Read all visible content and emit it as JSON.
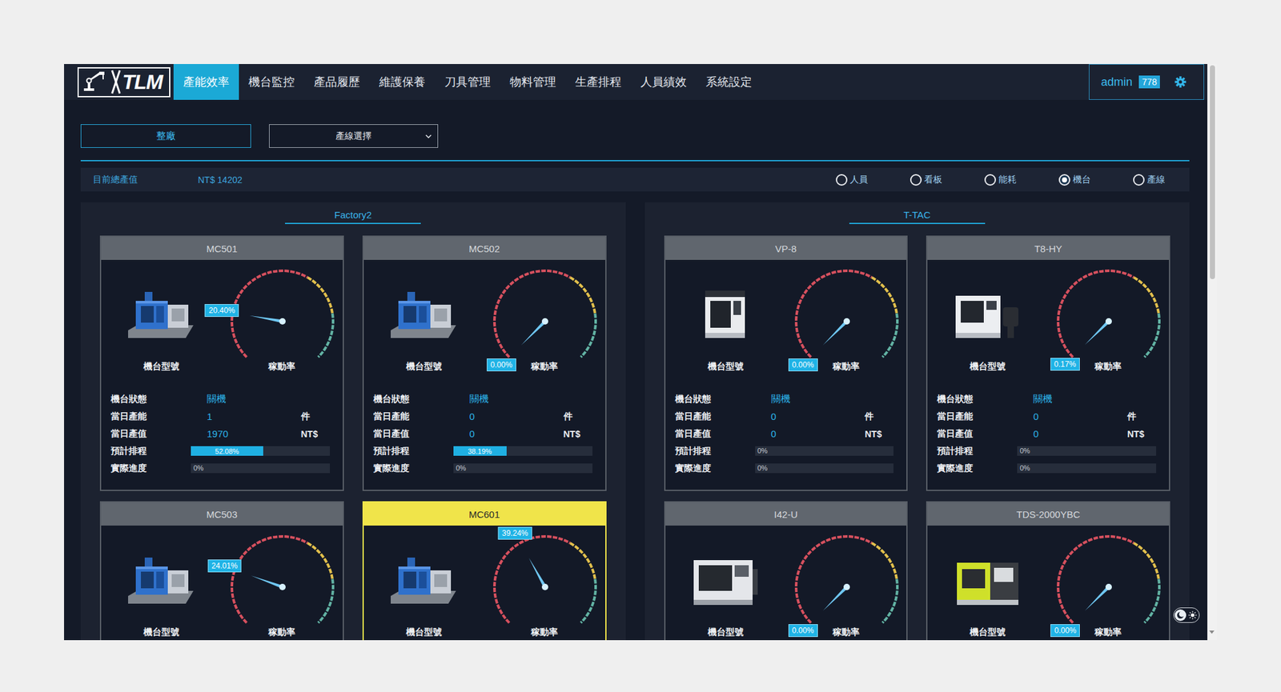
{
  "logo": {
    "text": "TLM"
  },
  "nav": {
    "items": [
      {
        "label": "產能效率",
        "selected": true
      },
      {
        "label": "機台監控",
        "selected": false
      },
      {
        "label": "產品履歷",
        "selected": false
      },
      {
        "label": "維護保養",
        "selected": false
      },
      {
        "label": "刀具管理",
        "selected": false
      },
      {
        "label": "物料管理",
        "selected": false
      },
      {
        "label": "生產排程",
        "selected": false
      },
      {
        "label": "人員績效",
        "selected": false
      },
      {
        "label": "系統設定",
        "selected": false
      }
    ]
  },
  "user": {
    "name": "admin",
    "badge": "778"
  },
  "filters": {
    "scope_button": "整廠",
    "line_select": "產線選擇"
  },
  "summary": {
    "label": "目前總產值",
    "value": "NT$ 14202",
    "views": [
      {
        "label": "人員",
        "selected": false
      },
      {
        "label": "看板",
        "selected": false
      },
      {
        "label": "能耗",
        "selected": false
      },
      {
        "label": "機台",
        "selected": true
      },
      {
        "label": "產線",
        "selected": false
      }
    ]
  },
  "groups": [
    {
      "title": "Factory2",
      "machines": [
        {
          "name": "MC501",
          "highlighted": false,
          "kind": "mill",
          "model_label": "機台型號",
          "gauge_label": "稼動率",
          "utilization": "20.40%",
          "level": 0.204,
          "stats": [
            {
              "kind": "value",
              "label": "機台狀態",
              "value": "關機"
            },
            {
              "kind": "value",
              "label": "當日產能",
              "value": "1",
              "unit": "件"
            },
            {
              "kind": "value",
              "label": "當日產值",
              "value": "1970",
              "unit": "NT$"
            },
            {
              "kind": "bar",
              "label": "預計排程",
              "reading": "52.08%",
              "level": 0.5208
            },
            {
              "kind": "bar",
              "label": "實際進度",
              "reading": "0%",
              "level": 0
            }
          ]
        },
        {
          "name": "MC502",
          "highlighted": false,
          "kind": "mill",
          "model_label": "機台型號",
          "gauge_label": "稼動率",
          "utilization": "0.00%",
          "level": 0,
          "stats": [
            {
              "kind": "value",
              "label": "機台狀態",
              "value": "關機"
            },
            {
              "kind": "value",
              "label": "當日產能",
              "value": "0",
              "unit": "件"
            },
            {
              "kind": "value",
              "label": "當日產值",
              "value": "0",
              "unit": "NT$"
            },
            {
              "kind": "bar",
              "label": "預計排程",
              "reading": "38.19%",
              "level": 0.3819
            },
            {
              "kind": "bar",
              "label": "實際進度",
              "reading": "0%",
              "level": 0
            }
          ]
        },
        {
          "name": "MC503",
          "highlighted": false,
          "kind": "mill",
          "model_label": "機台型號",
          "gauge_label": "稼動率",
          "utilization": "24.01%",
          "level": 0.2401,
          "stats": []
        },
        {
          "name": "MC601",
          "highlighted": true,
          "kind": "mill",
          "model_label": "機台型號",
          "gauge_label": "稼動率",
          "utilization": "39.24%",
          "level": 0.3924,
          "stats": []
        }
      ]
    },
    {
      "title": "T-TAC",
      "machines": [
        {
          "name": "VP-8",
          "highlighted": false,
          "kind": "vmc",
          "model_label": "機台型號",
          "gauge_label": "稼動率",
          "utilization": "0.00%",
          "level": 0,
          "stats": [
            {
              "kind": "value",
              "label": "機台狀態",
              "value": "關機"
            },
            {
              "kind": "value",
              "label": "當日產能",
              "value": "0",
              "unit": "件"
            },
            {
              "kind": "value",
              "label": "當日產值",
              "value": "0",
              "unit": "NT$"
            },
            {
              "kind": "bar",
              "label": "預計排程",
              "reading": "0%",
              "level": 0
            },
            {
              "kind": "bar",
              "label": "實際進度",
              "reading": "0%",
              "level": 0
            }
          ]
        },
        {
          "name": "T8-HY",
          "highlighted": false,
          "kind": "lathe",
          "model_label": "機台型號",
          "gauge_label": "稼動率",
          "utilization": "0.17%",
          "level": 0.0017,
          "stats": [
            {
              "kind": "value",
              "label": "機台狀態",
              "value": "關機"
            },
            {
              "kind": "value",
              "label": "當日產能",
              "value": "0",
              "unit": "件"
            },
            {
              "kind": "value",
              "label": "當日產值",
              "value": "0",
              "unit": "NT$"
            },
            {
              "kind": "bar",
              "label": "預計排程",
              "reading": "0%",
              "level": 0
            },
            {
              "kind": "bar",
              "label": "實際進度",
              "reading": "0%",
              "level": 0
            }
          ]
        },
        {
          "name": "I42-U",
          "highlighted": false,
          "kind": "turning",
          "model_label": "機台型號",
          "gauge_label": "稼動率",
          "utilization": "0.00%",
          "level": 0,
          "stats": []
        },
        {
          "name": "TDS-2000YBC",
          "highlighted": false,
          "kind": "compact",
          "model_label": "機台型號",
          "gauge_label": "稼動率",
          "utilization": "0.00%",
          "level": 0,
          "stats": []
        }
      ]
    }
  ],
  "theme_toggle": {
    "dark": true
  }
}
